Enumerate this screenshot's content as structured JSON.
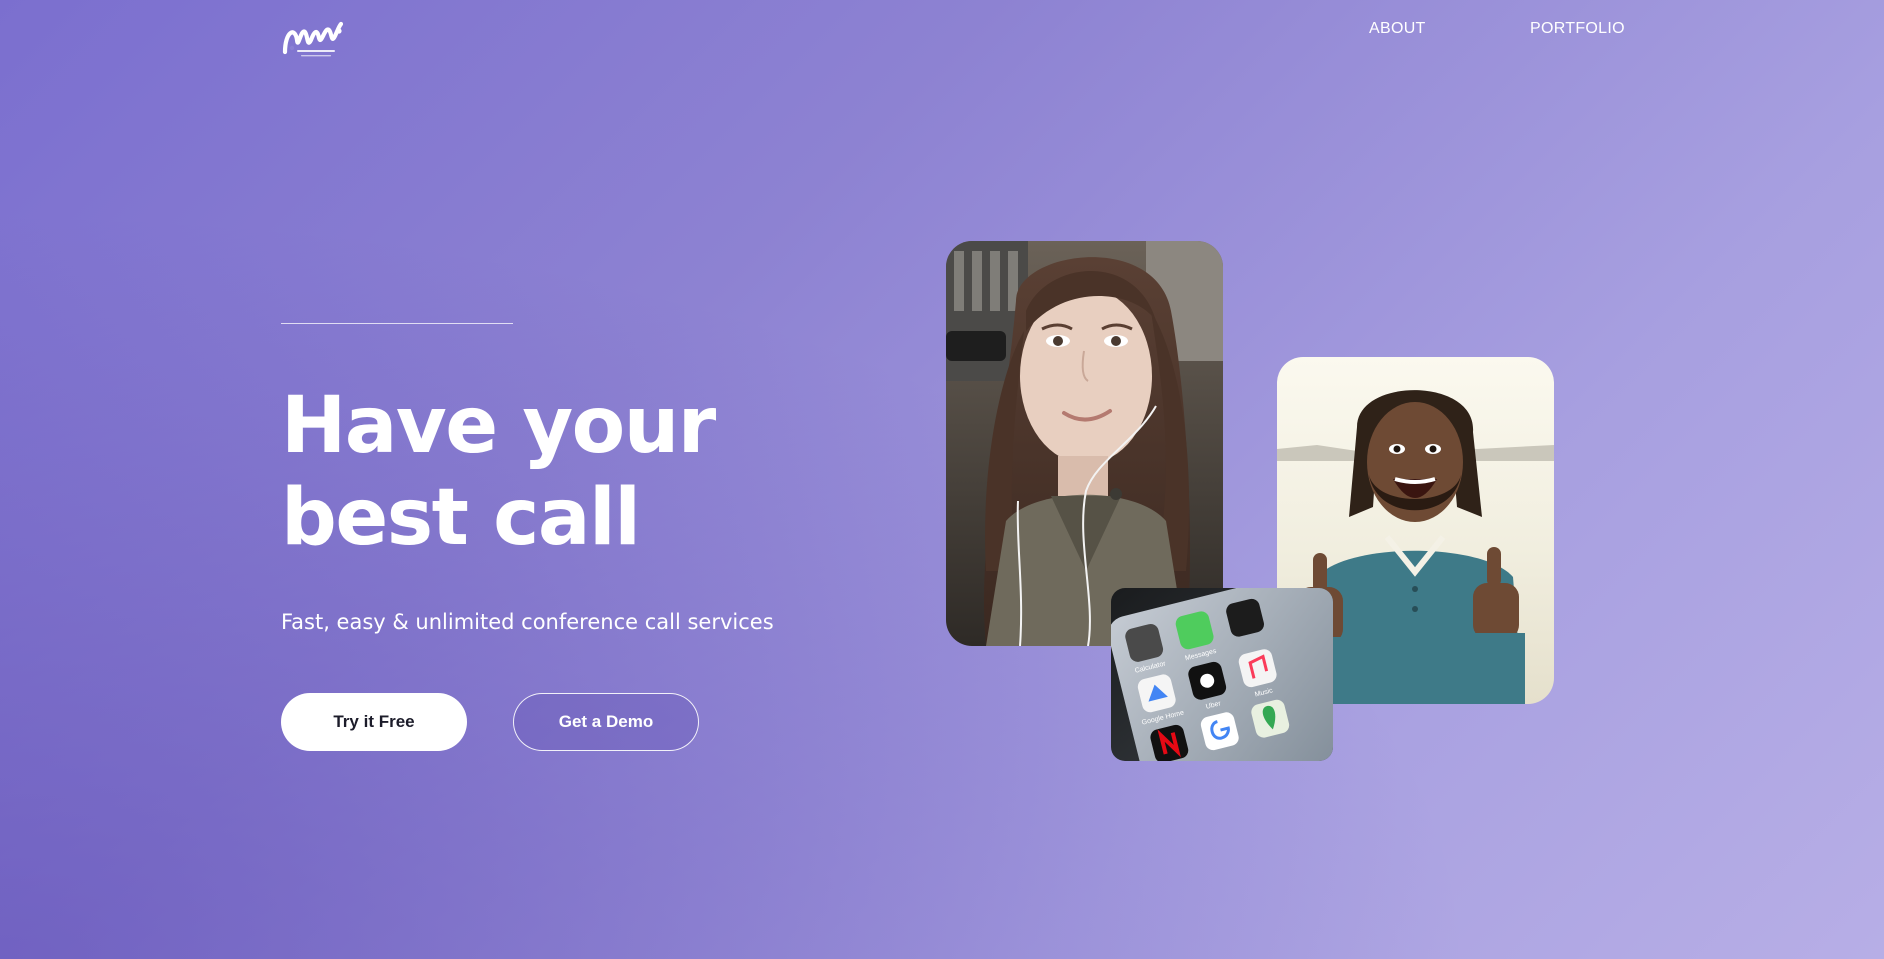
{
  "brand": {
    "logo_alt": "awf logo"
  },
  "nav": {
    "items": [
      {
        "label": "ABOUT"
      },
      {
        "label": "PORTFOLIO"
      }
    ]
  },
  "hero": {
    "headline_line1": "Have your",
    "headline_line2": "best call",
    "subtitle": "Fast, easy & unlimited conference call services",
    "primary_cta": "Try it Free",
    "secondary_cta": "Get a Demo"
  },
  "images": {
    "woman": "photo of smiling woman with earphones",
    "man": "photo of excited man giving thumbs up",
    "phone": "photo of smartphone home screen with apps",
    "phone_apps": [
      "Calculator",
      "Messages",
      "Google Home",
      "Uber",
      "Netflix",
      "Music"
    ]
  },
  "colors": {
    "background_start": "#7b6fcf",
    "background_end": "#b7aee6",
    "primary_button": "#ffffff",
    "text": "#ffffff"
  }
}
